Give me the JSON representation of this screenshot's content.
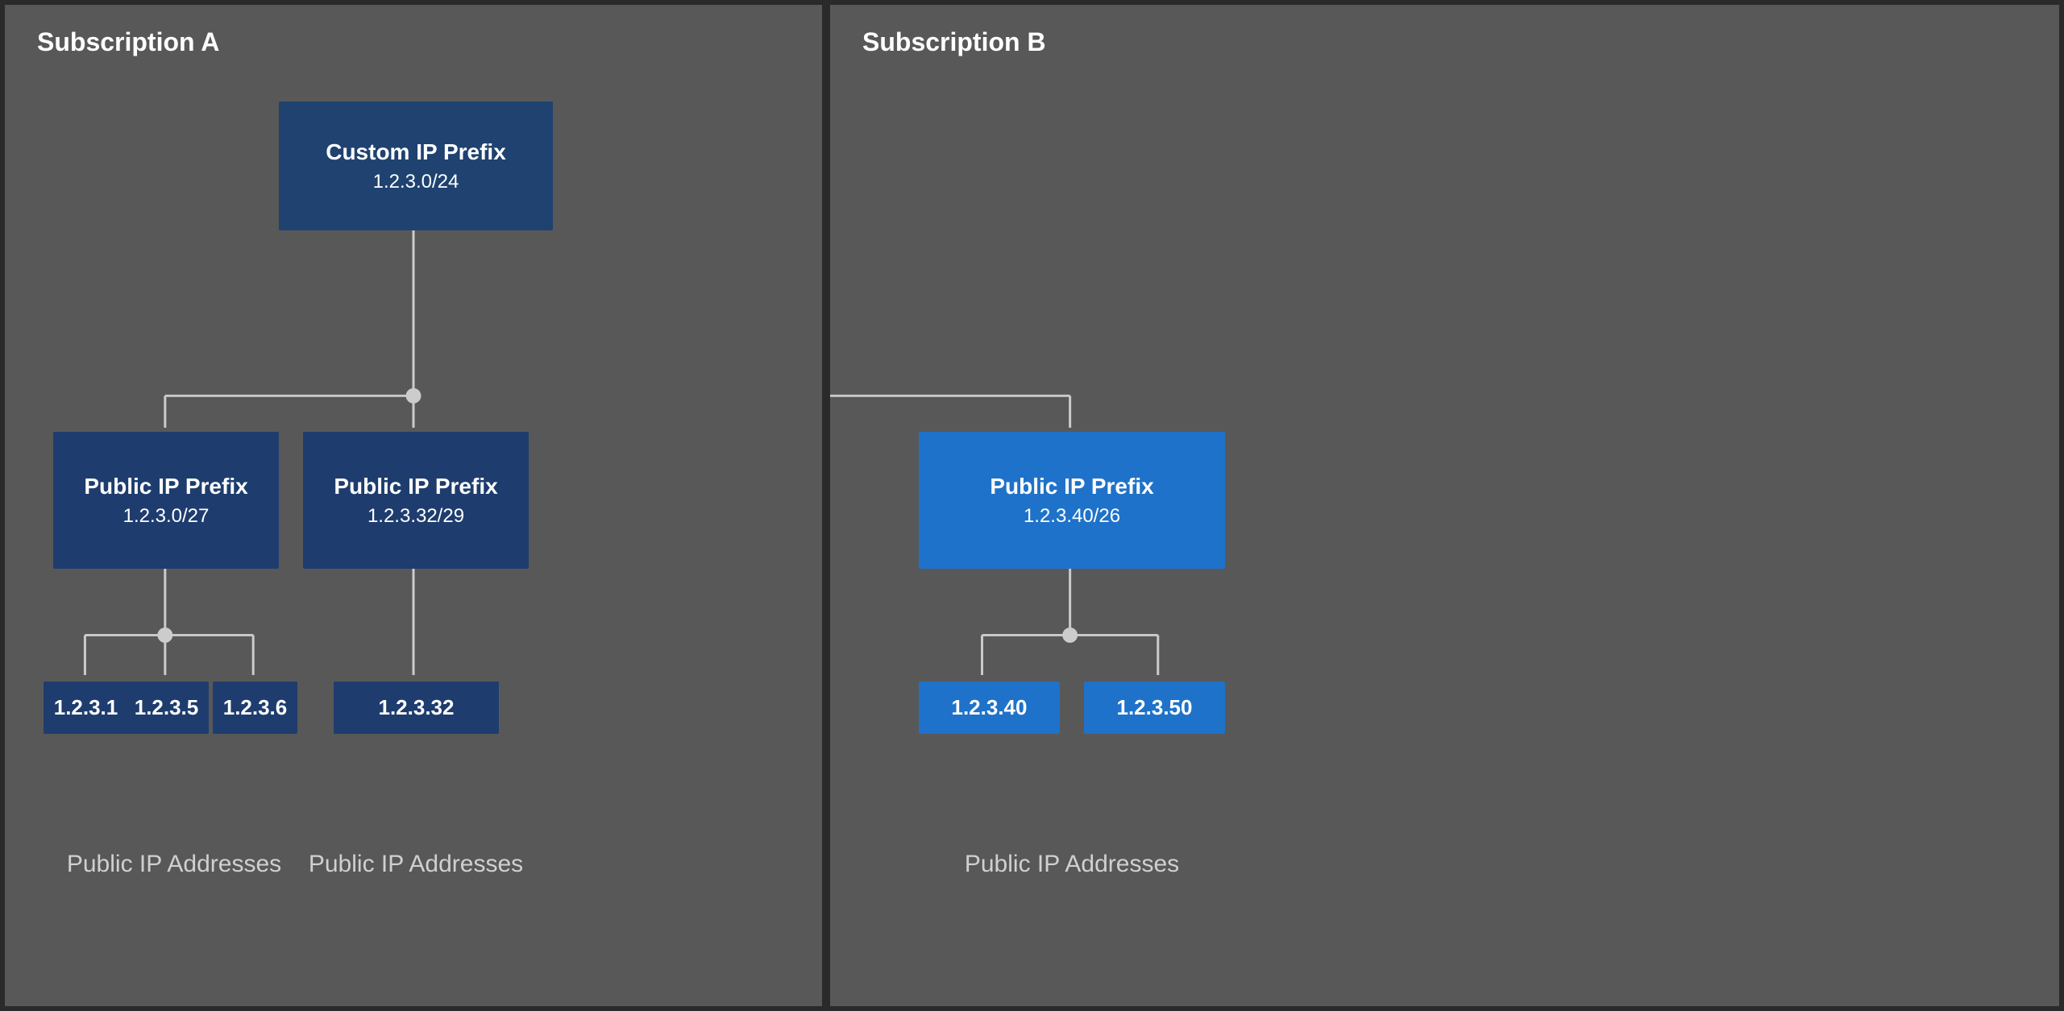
{
  "subscription_a": {
    "label": "Subscription A"
  },
  "subscription_b": {
    "label": "Subscription B"
  },
  "custom_ip_prefix": {
    "title": "Custom IP Prefix",
    "ip": "1.2.3.0/24"
  },
  "prefix_a1": {
    "title": "Public IP Prefix",
    "ip": "1.2.3.0/27"
  },
  "prefix_a2": {
    "title": "Public IP Prefix",
    "ip": "1.2.3.32/29"
  },
  "prefix_b1": {
    "title": "Public IP Prefix",
    "ip": "1.2.3.40/26"
  },
  "ips_a1": [
    "1.2.3.1",
    "1.2.3.5",
    "1.2.3.6"
  ],
  "ip_a2": "1.2.3.32",
  "ips_b1": [
    "1.2.3.40",
    "1.2.3.50"
  ],
  "public_ip_addresses_label": "Public IP Addresses"
}
